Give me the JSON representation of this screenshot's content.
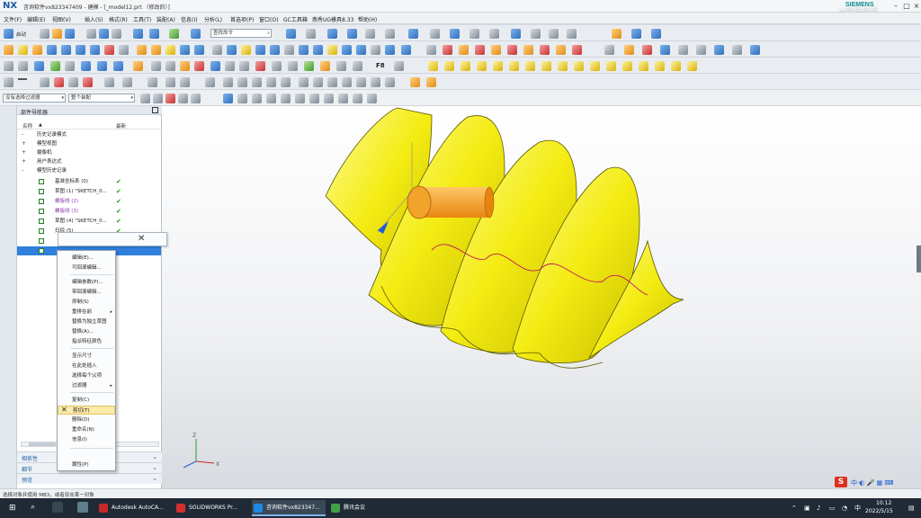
{
  "titlebar": {
    "logo": "NX",
    "title": "咨询软件vx823347409 - 建模 - [_model12.prt （修改的）]",
    "brand": "SIEMENS",
    "watermark": "◎绝技求源"
  },
  "menubar": {
    "items": [
      "文件(F)",
      "编辑(E)",
      "视图(V)",
      "插入(S)",
      "格式(R)",
      "工具(T)",
      "装配(A)",
      "信息(I)",
      "分析(L)",
      "首选项(P)",
      "窗口(O)",
      "GC工具箱",
      "燕秀UG模具8.33",
      "帮助(H)"
    ]
  },
  "toolbar": {
    "start_label": "启动",
    "command_finder": "查找命令",
    "selection_filter": "没有选择过滤器",
    "assembly_scope": "整个装配"
  },
  "navigator": {
    "title": "部件导航器",
    "col_name": "名称",
    "col_latest": "最新",
    "items": [
      {
        "label": "历史记录模式",
        "indent": 0,
        "expand": "-"
      },
      {
        "label": "模型视图",
        "indent": 0,
        "expand": "+"
      },
      {
        "label": "摄像机",
        "indent": 0,
        "expand": "+"
      },
      {
        "label": "用户表达式",
        "indent": 0,
        "expand": "+"
      },
      {
        "label": "模型历史记录",
        "indent": 0,
        "expand": "-"
      },
      {
        "label": "基准坐标系 (0)",
        "indent": 1,
        "ok": true
      },
      {
        "label": "草图 (1) \"SKETCH_0...",
        "indent": 1,
        "ok": true
      },
      {
        "label": "螺旋线 (2)",
        "indent": 1,
        "ok": true
      },
      {
        "label": "螺旋线 (3)",
        "indent": 1,
        "ok": true
      },
      {
        "label": "草图 (4) \"SKETCH_0...",
        "indent": 1,
        "ok": true
      },
      {
        "label": "扫掠 (5)",
        "indent": 1,
        "ok": true
      },
      {
        "label": "",
        "indent": 1
      },
      {
        "label": "",
        "indent": 1,
        "selected": true
      }
    ],
    "sections": [
      "相依性",
      "细节",
      "预览"
    ]
  },
  "context_menu": {
    "items": [
      {
        "label": "编辑(E)..."
      },
      {
        "label": "可回滚编辑..."
      },
      {
        "sep": true
      },
      {
        "label": "编辑参数(P)..."
      },
      {
        "label": "带回滚编辑..."
      },
      {
        "label": "抑制(S)"
      },
      {
        "label": "重排在前",
        "sub": true
      },
      {
        "label": "替换为独立草图"
      },
      {
        "label": "替换(A)..."
      },
      {
        "label": "指派特征颜色"
      },
      {
        "sep": true
      },
      {
        "label": "显示尺寸"
      },
      {
        "label": "在此处插入"
      },
      {
        "label": "选择每个父项"
      },
      {
        "label": "过滤器",
        "sub": true
      },
      {
        "sep": true
      },
      {
        "label": "复制(C)"
      },
      {
        "label": "剪切(T)",
        "highlight": true
      },
      {
        "label": "删除(D)"
      },
      {
        "label": "重命名(N)"
      },
      {
        "label": "信息(I)"
      },
      {
        "sep": true
      },
      {
        "label": "属性(P)"
      }
    ]
  },
  "status": {
    "text": "选择对象并使用 MB3，或者双击某一对象"
  },
  "taskbar": {
    "apps": [
      {
        "label": "Autodesk AutoCA...",
        "color": "#c62828"
      },
      {
        "label": "SOLIDWORKS Pr...",
        "color": "#d32f2f"
      },
      {
        "label": "咨询软件vx823347...",
        "color": "#1e88e5",
        "active": true
      },
      {
        "label": "腾讯会议",
        "color": "#43a047"
      }
    ],
    "time": "10:12",
    "date": "2022/5/15"
  }
}
